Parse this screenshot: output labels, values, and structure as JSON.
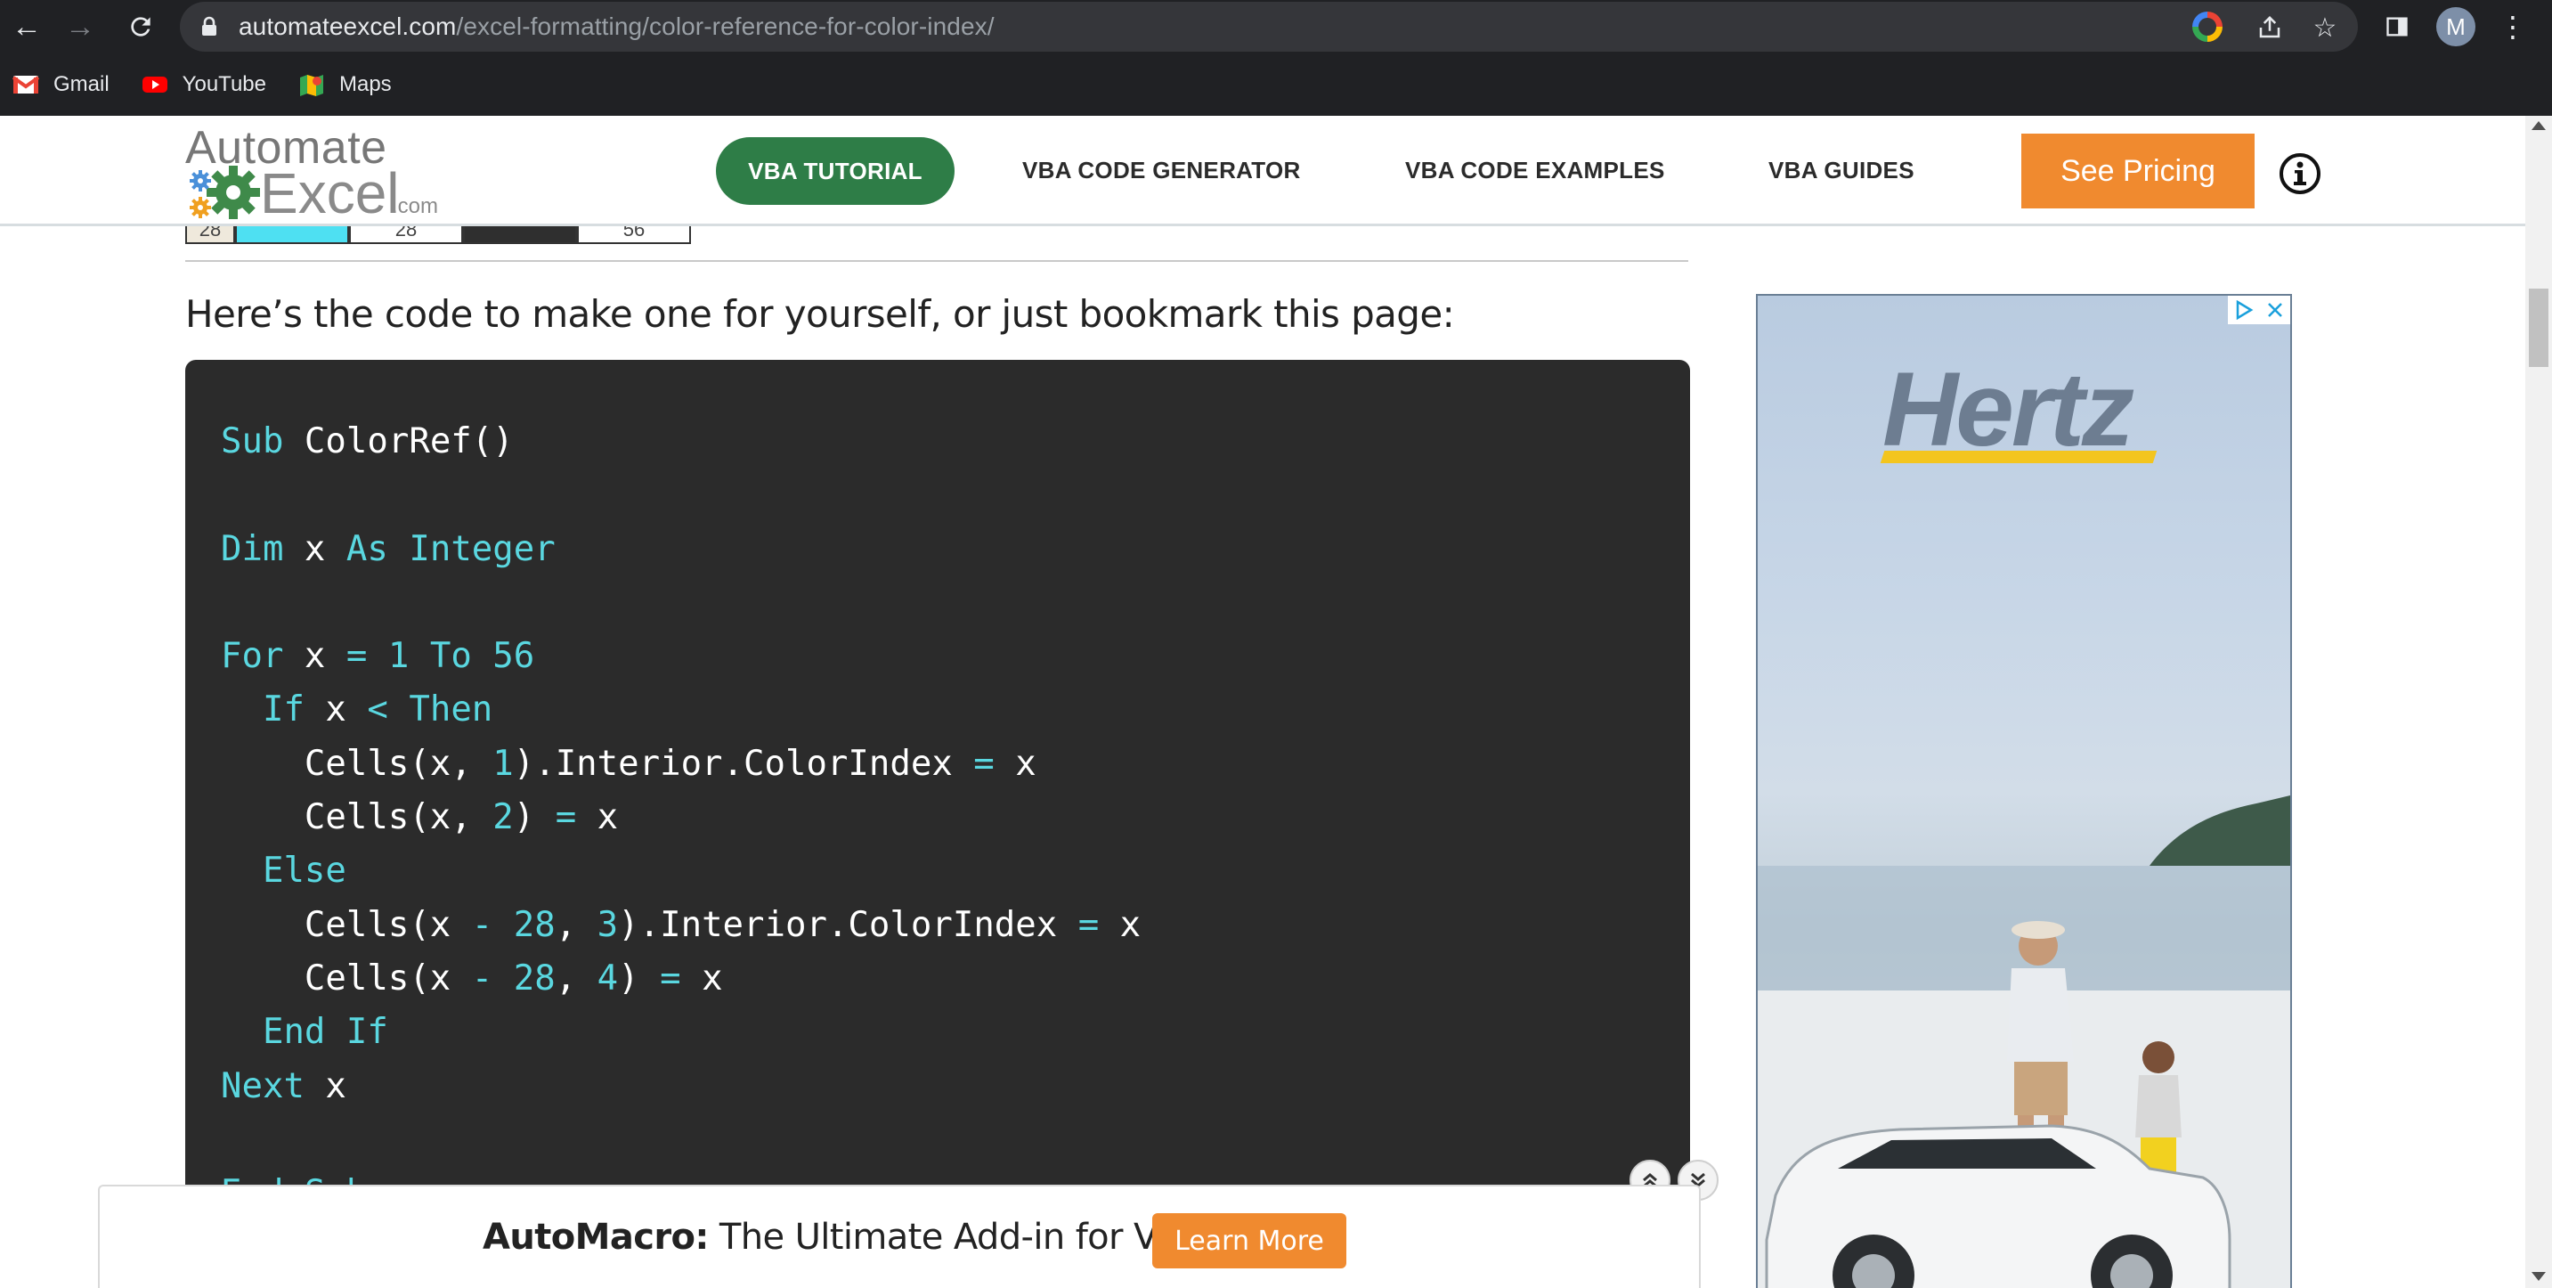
{
  "browser": {
    "url_host": "automateexcel.com",
    "url_path": "/excel-formatting/color-reference-for-color-index/",
    "profile_initial": "M",
    "bookmarks": [
      {
        "label": "Gmail",
        "icon": "gmail-icon"
      },
      {
        "label": "YouTube",
        "icon": "youtube-icon"
      },
      {
        "label": "Maps",
        "icon": "maps-icon"
      }
    ]
  },
  "header": {
    "logo_line1": "Automate",
    "logo_line2": "Excel",
    "logo_suffix": ".com",
    "nav": {
      "vba_tutorial": "VBA TUTORIAL",
      "code_generator": "VBA CODE GENERATOR",
      "code_examples": "VBA CODE EXAMPLES",
      "guides": "VBA GUIDES"
    },
    "cta": "See Pricing"
  },
  "table_strip": {
    "cells": [
      "28",
      "",
      "28",
      "",
      "56"
    ]
  },
  "content": {
    "intro": "Here’s the code to make one for yourself, or just bookmark this page:"
  },
  "ad": {
    "brand": "Hertz"
  },
  "promo": {
    "brand": "AutoMacro:",
    "tagline": " The Ultimate Add-in for VBA",
    "button": "Learn More"
  },
  "colors": {
    "brand_green": "#2e7d47",
    "accent_orange": "#f08a2f",
    "code_bg": "#2b2b2b",
    "code_keyword": "#5ad7e0",
    "chrome_bg": "#202124"
  }
}
